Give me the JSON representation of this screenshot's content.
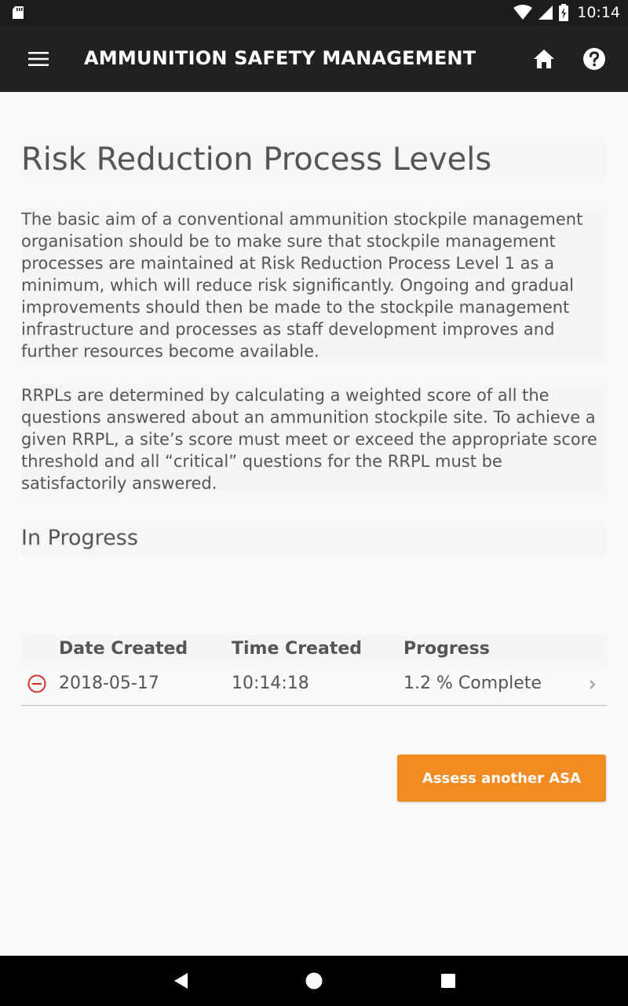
{
  "status": {
    "time": "10:14"
  },
  "appbar": {
    "title": "AMMUNITION SAFETY MANAGEMENT"
  },
  "page": {
    "title": "Risk Reduction Process Levels",
    "paragraph1": "The basic aim of a conventional ammunition stockpile management organisation should be to make sure that stockpile management processes are maintained at Risk Reduction Process Level 1 as a minimum, which will reduce risk significantly. Ongoing and gradual improvements should then be made to the stockpile management infrastructure and processes as staff development improves and further resources become available.",
    "paragraph2": "RRPLs are determined by calculating a weighted score of all the questions answered about an ammunition stockpile site. To achieve a given RRPL, a site’s score must meet or exceed the appropriate score threshold and all “critical” questions for the RRPL must be satisfactorily answered.",
    "section_title": "In Progress"
  },
  "table": {
    "headers": [
      "Date Created",
      "Time Created",
      "Progress"
    ],
    "rows": [
      {
        "date": "2018-05-17",
        "time": "10:14:18",
        "progress": "1.2 % Complete"
      }
    ]
  },
  "cta": {
    "label": "Assess another ASA"
  },
  "colors": {
    "accent": "#f28b22",
    "remove": "#d32f2f",
    "appbar": "#212121"
  }
}
